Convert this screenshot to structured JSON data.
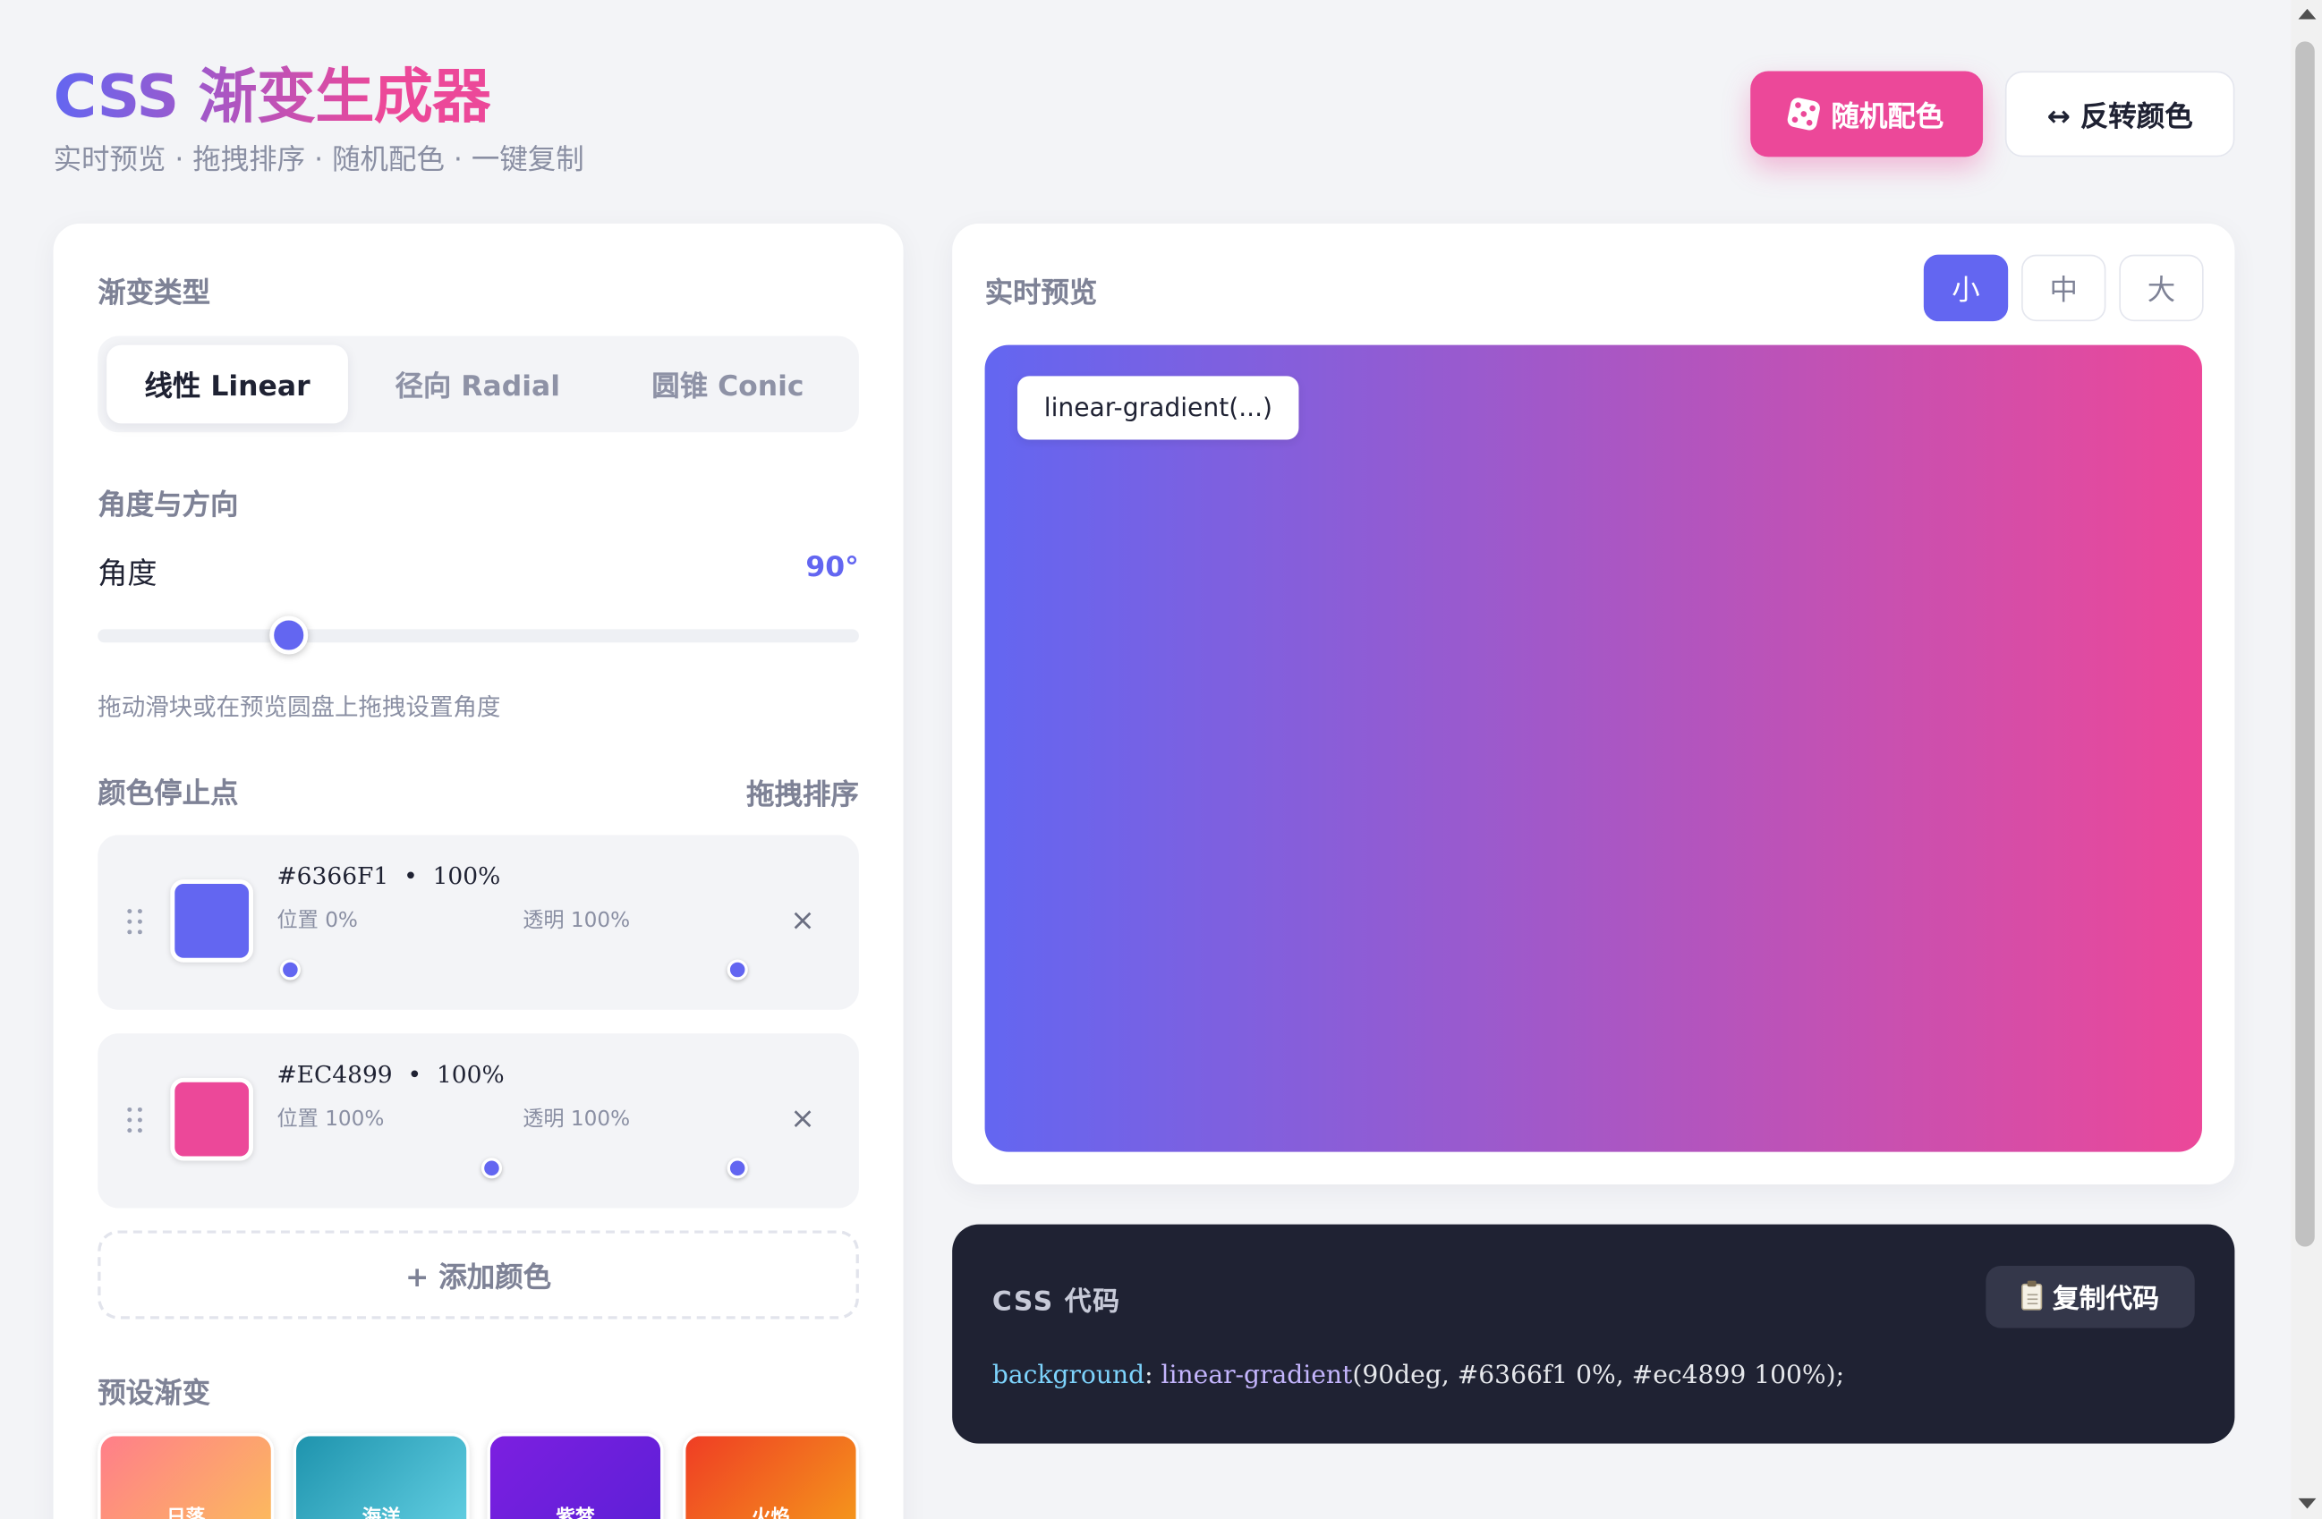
{
  "header": {
    "title": "CSS 渐变生成器",
    "subtitle": "实时预览 · 拖拽排序 · 随机配色 · 一键复制",
    "random_button": "随机配色",
    "reverse_button": "↔ 反转颜色"
  },
  "gradient_type": {
    "label": "渐变类型",
    "tabs": [
      {
        "label": "线性 Linear",
        "active": true
      },
      {
        "label": "径向 Radial",
        "active": false
      },
      {
        "label": "圆锥 Conic",
        "active": false
      }
    ]
  },
  "angle": {
    "section_label": "角度与方向",
    "label": "角度",
    "value_text": "90°",
    "value_deg": 90,
    "hint": "拖动滑块或在预览圆盘上拖拽设置角度"
  },
  "stops": {
    "label": "颜色停止点",
    "sort_label": "拖拽排序",
    "items": [
      {
        "hex": "#6366F1",
        "opacity_text": "100%",
        "position_label": "位置 0%",
        "opacity_label": "透明 100%",
        "color": "#6366f1",
        "position": 0,
        "opacity": 100
      },
      {
        "hex": "#EC4899",
        "opacity_text": "100%",
        "position_label": "位置 100%",
        "opacity_label": "透明 100%",
        "color": "#ec4899",
        "position": 100,
        "opacity": 100
      }
    ],
    "remove_symbol": "×",
    "add_button": "+ 添加颜色"
  },
  "presets": {
    "label": "预设渐变",
    "items": [
      {
        "name": "日落",
        "from": "#ff7e8a",
        "to": "#fbbf5a"
      },
      {
        "name": "海洋",
        "from": "#1e93ad",
        "to": "#67d3e6"
      },
      {
        "name": "紫梦",
        "from": "#7c1fe0",
        "to": "#5b1fd6"
      },
      {
        "name": "火焰",
        "from": "#ef3d24",
        "to": "#f59e1b"
      }
    ]
  },
  "preview": {
    "title": "实时预览",
    "sizes": [
      {
        "label": "小",
        "active": true
      },
      {
        "label": "中",
        "active": false
      },
      {
        "label": "大",
        "active": false
      }
    ],
    "chip": "linear-gradient(...)"
  },
  "code": {
    "title": "CSS 代码",
    "copy_button": "复制代码",
    "property": "background",
    "colon": ": ",
    "function": "linear-gradient",
    "args": "(90deg, #6366f1 0%, #ec4899 100%);"
  },
  "colors": {
    "accent": "#6366f1",
    "pink": "#ec4899",
    "code_bg": "#1f2233"
  }
}
